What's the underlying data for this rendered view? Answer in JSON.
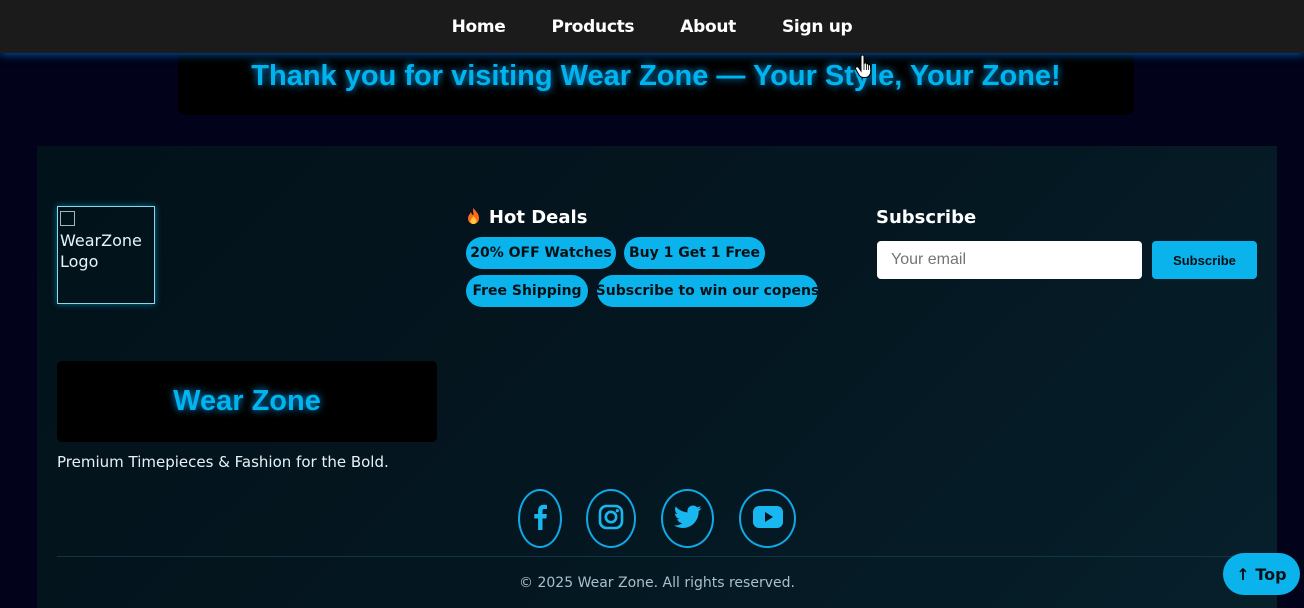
{
  "nav": {
    "items": [
      {
        "label": "Home"
      },
      {
        "label": "Products"
      },
      {
        "label": "About"
      },
      {
        "label": "Sign up"
      }
    ]
  },
  "banner": {
    "text": "Thank you for visiting Wear Zone — Your Style, Your Zone!"
  },
  "footer": {
    "logo_alt": "WearZone Logo",
    "brand": "Wear Zone",
    "tagline": "Premium Timepieces & Fashion for the Bold.",
    "deals": {
      "icon": "fire-icon",
      "title": "Hot Deals",
      "items": [
        {
          "label": "20% OFF Watches"
        },
        {
          "label": "Buy 1 Get 1 Free"
        },
        {
          "label": "Free Shipping"
        },
        {
          "label": "Subscribe to win our copens"
        }
      ]
    },
    "subscribe": {
      "title": "Subscribe",
      "placeholder": "Your email",
      "button_label": "Subscribe"
    },
    "social": [
      {
        "icon": "facebook-icon"
      },
      {
        "icon": "instagram-icon"
      },
      {
        "icon": "twitter-icon"
      },
      {
        "icon": "youtube-icon"
      }
    ],
    "copyright": "© 2025 Wear Zone. All rights reserved."
  },
  "back_to_top": {
    "label": "↑ Top"
  },
  "colors": {
    "accent": "#0ab3ec",
    "glow_text": "#00b4f0",
    "nav_bg": "#1b1b1b",
    "page_bg": "#02021a",
    "social_border": "#10a8e6"
  }
}
